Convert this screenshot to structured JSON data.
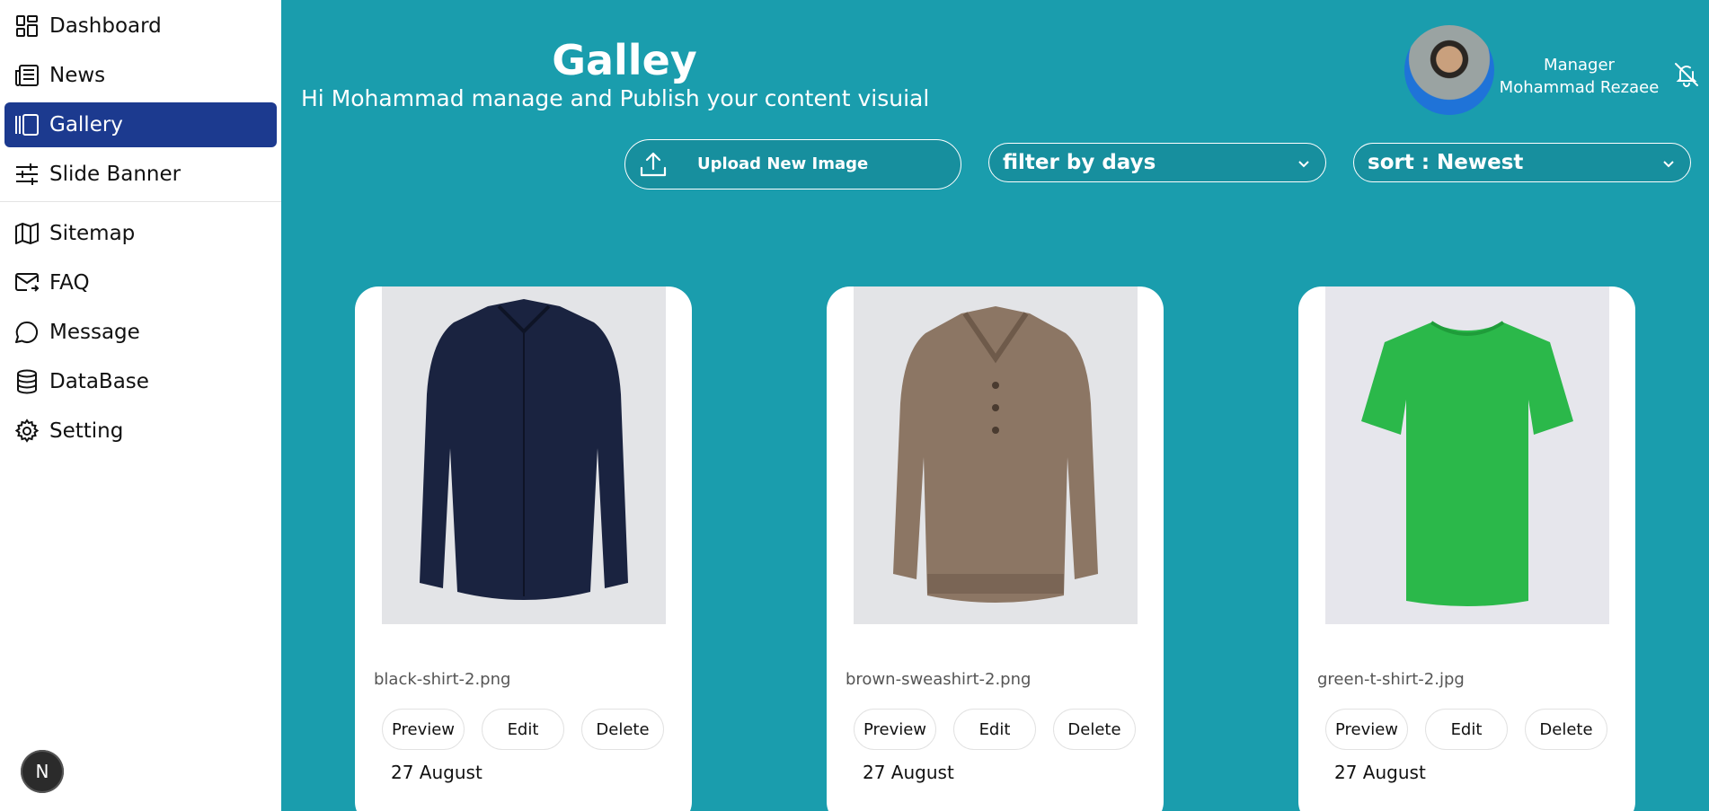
{
  "sidebar": {
    "items": [
      {
        "label": "Dashboard",
        "icon": "dashboard-icon"
      },
      {
        "label": "News",
        "icon": "newspaper-icon"
      },
      {
        "label": "Gallery",
        "icon": "gallery-icon",
        "active": true
      },
      {
        "label": "Slide Banner",
        "icon": "sliders-icon"
      },
      {
        "label": "Sitemap",
        "icon": "map-icon"
      },
      {
        "label": "FAQ",
        "icon": "mail-icon"
      },
      {
        "label": "Message",
        "icon": "chat-icon"
      },
      {
        "label": "DataBase",
        "icon": "database-icon"
      },
      {
        "label": "Setting",
        "icon": "gear-icon"
      }
    ],
    "badge": "N"
  },
  "header": {
    "title": "Galley",
    "subtitle": "Hi Mohammad manage and Publish your content visuial",
    "user_role": "Manager",
    "user_name": "Mohammad Rezaee"
  },
  "controls": {
    "upload_label": "Upload New Image",
    "filter_label": "filter by days",
    "sort_label": "sort : Newest"
  },
  "cards": [
    {
      "filename": "black-shirt-2.png",
      "preview": "Preview",
      "edit": "Edit",
      "delete": "Delete",
      "date": "27 August"
    },
    {
      "filename": "brown-sweashirt-2.png",
      "preview": "Preview",
      "edit": "Edit",
      "delete": "Delete",
      "date": "27 August"
    },
    {
      "filename": "green-t-shirt-2.jpg",
      "preview": "Preview",
      "edit": "Edit",
      "delete": "Delete",
      "date": "27 August"
    }
  ],
  "colors": {
    "background": "#1a9dad",
    "sidebar_active": "#1c3a8f",
    "sidebar_bg": "#ffffff"
  }
}
